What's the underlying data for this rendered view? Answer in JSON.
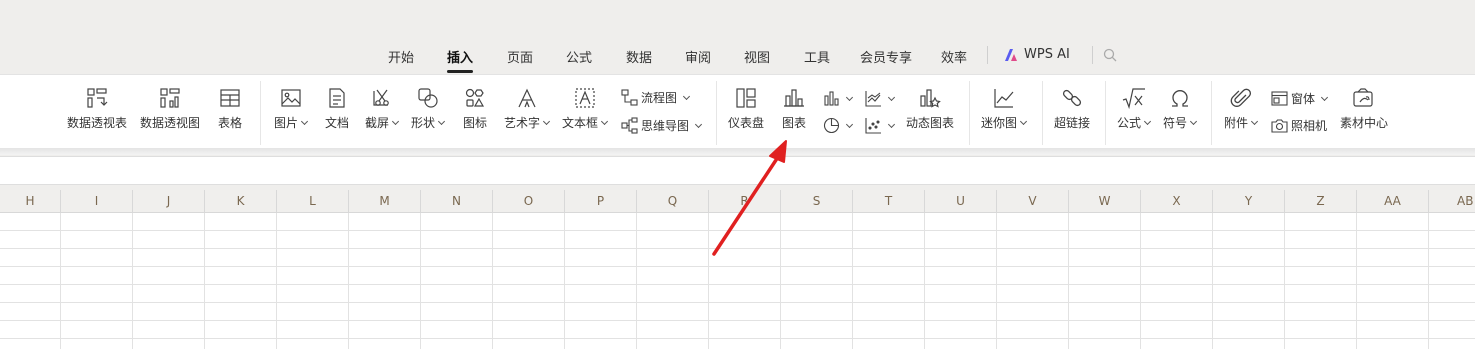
{
  "tabs": [
    "开始",
    "插入",
    "页面",
    "公式",
    "数据",
    "审阅",
    "视图",
    "工具",
    "会员专享",
    "效率"
  ],
  "active_tab": "插入",
  "wps_ai_label": "WPS AI",
  "ribbon": {
    "pivot_table": "数据透视表",
    "pivot_chart": "数据透视图",
    "table": "表格",
    "picture": "图片",
    "document": "文档",
    "screenshot": "截屏",
    "shape": "形状",
    "icon": "图标",
    "wordart": "艺术字",
    "textbox": "文本框",
    "flowchart": "流程图",
    "mindmap": "思维导图",
    "dashboard": "仪表盘",
    "chart": "图表",
    "dynamic_chart": "动态图表",
    "sparkline": "迷你图",
    "hyperlink": "超链接",
    "formula": "公式",
    "symbol": "符号",
    "attachment": "附件",
    "form": "窗体",
    "camera": "照相机",
    "material_center": "素材中心"
  },
  "columns": [
    "H",
    "I",
    "J",
    "K",
    "L",
    "M",
    "N",
    "O",
    "P",
    "Q",
    "R",
    "S",
    "T",
    "U",
    "V",
    "W",
    "X",
    "Y",
    "Z",
    "AA",
    "AB"
  ],
  "colors": {
    "annotation_arrow": "#e02020",
    "header_text": "#7a6850"
  }
}
